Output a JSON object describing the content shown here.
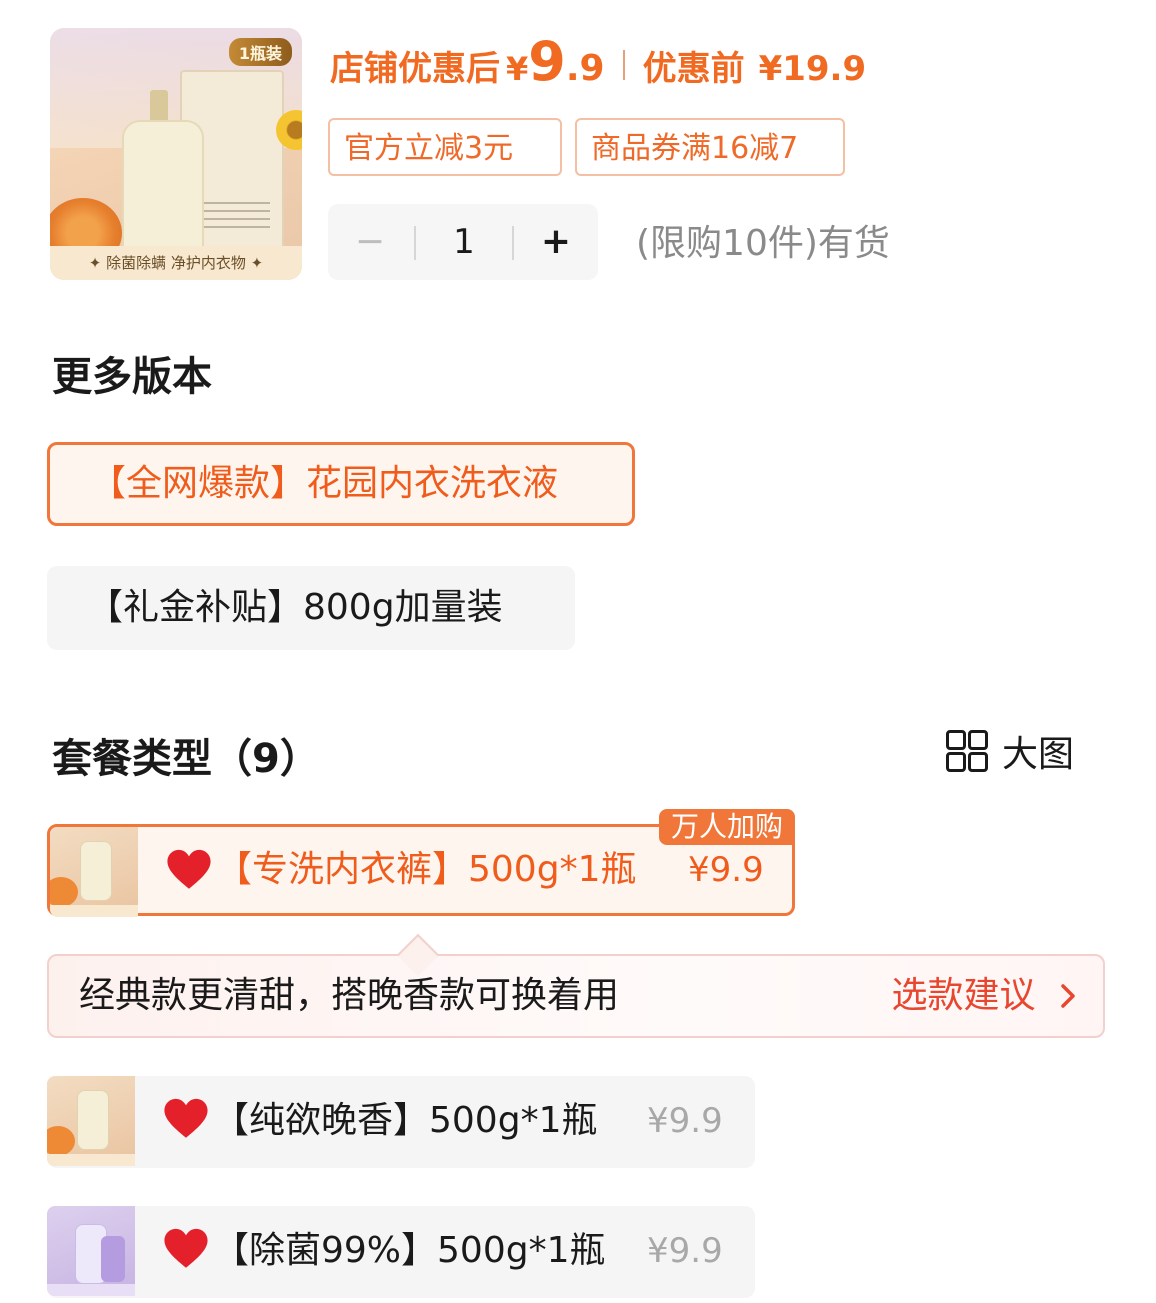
{
  "product": {
    "image_badge": "1瓶装",
    "image_caption": "✦ 除菌除螨 净护内衣物 ✦"
  },
  "price": {
    "after_label": "店铺优惠后",
    "currency": "¥",
    "after_int": "9",
    "after_dec": ".9",
    "before_label": "优惠前",
    "before_value": "¥19.9",
    "accent_color": "#f16a22"
  },
  "promos": [
    {
      "label": "官方立减3元"
    },
    {
      "label": "商品券满16减7"
    }
  ],
  "quantity": {
    "minus": "−",
    "value": "1",
    "plus": "+",
    "stock_text": "(限购10件)有货"
  },
  "versions": {
    "title": "更多版本",
    "items": [
      {
        "label": "【全网爆款】花园内衣洗衣液",
        "selected": true
      },
      {
        "label": "【礼金补贴】800g加量装",
        "selected": false
      }
    ]
  },
  "packages": {
    "title": "套餐类型（9）",
    "view_toggle": "大图",
    "view_icon": "grid-icon",
    "items": [
      {
        "label": "【专洗内衣裤】500g*1瓶",
        "price": "¥9.9",
        "badge": "万人加购",
        "icon": "heart-icon",
        "selected": true
      },
      {
        "label": "【纯欲晚香】500g*1瓶",
        "price": "¥9.9",
        "icon": "heart-icon",
        "selected": false
      },
      {
        "label": "【除菌99%】500g*1瓶",
        "price": "¥9.9",
        "icon": "heart-icon",
        "selected": false
      }
    ]
  },
  "tip": {
    "text": "经典款更清甜，搭晚香款可换着用",
    "link": "选款建议",
    "link_icon": "chevron-right-icon"
  }
}
